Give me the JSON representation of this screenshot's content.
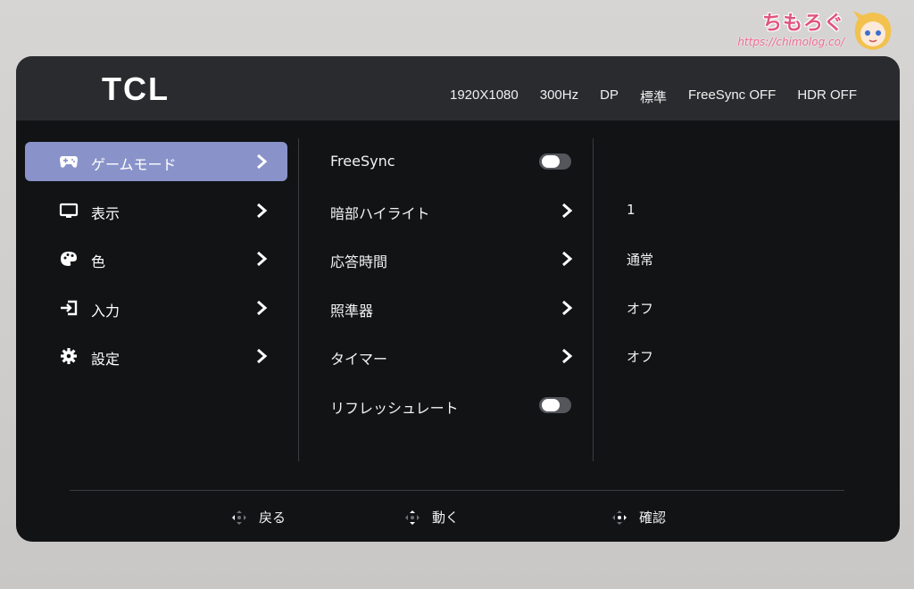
{
  "watermark": {
    "title": "ちもろぐ",
    "url": "https://chimolog.co/"
  },
  "header": {
    "logo": "TCL",
    "status": [
      "1920X1080",
      "300Hz",
      "DP",
      "標準",
      "FreeSync OFF",
      "HDR OFF"
    ]
  },
  "menu": {
    "items": [
      {
        "label": "ゲームモード",
        "icon": "gamepad-icon",
        "active": true
      },
      {
        "label": "表示",
        "icon": "monitor-icon",
        "active": false
      },
      {
        "label": "色",
        "icon": "palette-icon",
        "active": false
      },
      {
        "label": "入力",
        "icon": "input-icon",
        "active": false
      },
      {
        "label": "設定",
        "icon": "gear-icon",
        "active": false
      }
    ]
  },
  "settings": {
    "rows": [
      {
        "label": "FreeSync",
        "control": "toggle",
        "toggle_on": false,
        "value": ""
      },
      {
        "label": "暗部ハイライト",
        "control": "chevron",
        "value": "1"
      },
      {
        "label": "応答時間",
        "control": "chevron",
        "value": "通常"
      },
      {
        "label": "照準器",
        "control": "chevron",
        "value": "オフ"
      },
      {
        "label": "タイマー",
        "control": "chevron",
        "value": "オフ"
      },
      {
        "label": "リフレッシュレート",
        "control": "toggle",
        "toggle_on": false,
        "value": ""
      }
    ]
  },
  "footer": {
    "back": "戻る",
    "move": "動く",
    "confirm": "確認"
  },
  "colors": {
    "accent": "#8993c9",
    "panel": "#121315",
    "header": "#2a2b2e"
  }
}
